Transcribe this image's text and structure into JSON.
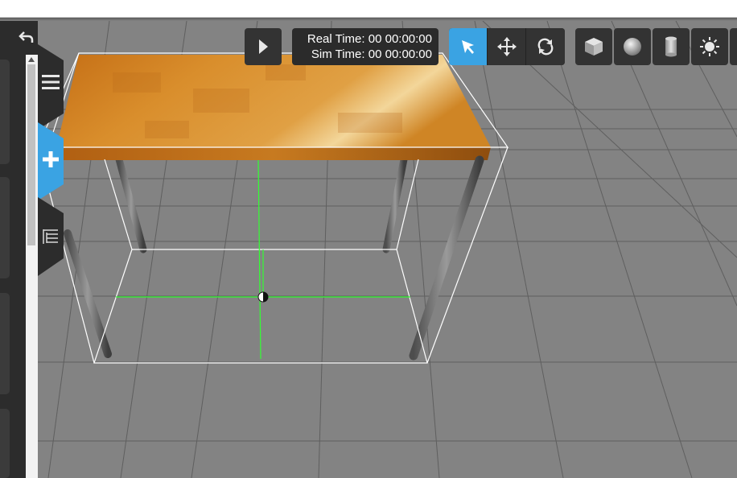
{
  "time": {
    "real_time_label": "Real Time:",
    "real_time_value": "00 00:00:00",
    "sim_time_label": "Sim Time:",
    "sim_time_value": "00 00:00:00"
  },
  "toolbar": {
    "play": "play-icon",
    "modes": [
      {
        "name": "select-mode",
        "icon": "arrow-icon",
        "active": true
      },
      {
        "name": "translate-mode",
        "icon": "move-icon",
        "active": false
      },
      {
        "name": "rotate-mode",
        "icon": "rotate-icon",
        "active": false
      }
    ],
    "shapes": [
      {
        "name": "box-shape",
        "icon": "box-icon"
      },
      {
        "name": "sphere-shape",
        "icon": "sphere-icon"
      },
      {
        "name": "cylinder-shape",
        "icon": "cylinder-icon"
      },
      {
        "name": "point-light",
        "icon": "light-icon"
      }
    ]
  },
  "side_tabs": [
    {
      "name": "menu-tab",
      "icon": "hamburger-icon",
      "active": false
    },
    {
      "name": "insert-tab",
      "icon": "plus-icon",
      "active": true
    },
    {
      "name": "tree-tab",
      "icon": "tree-icon",
      "active": false
    }
  ],
  "colors": {
    "accent": "#3aa3e3",
    "ground": "#838383",
    "toolbar": "#333333",
    "selection": "#ffffff",
    "axis": "#33ff33"
  }
}
